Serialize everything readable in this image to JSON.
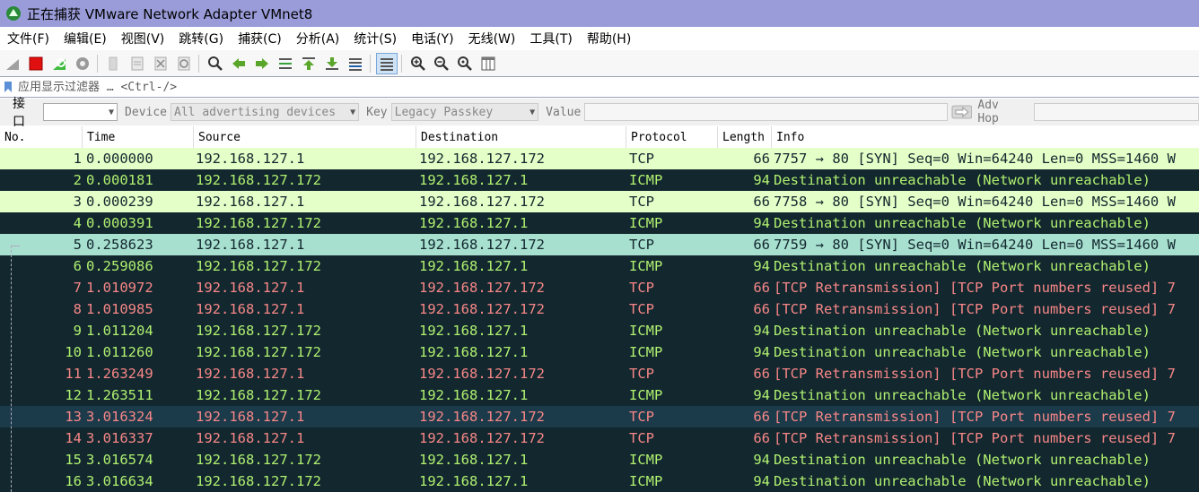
{
  "window": {
    "title": "正在捕获 VMware Network Adapter VMnet8"
  },
  "menu": [
    "文件(F)",
    "编辑(E)",
    "视图(V)",
    "跳转(G)",
    "捕获(C)",
    "分析(A)",
    "统计(S)",
    "电话(Y)",
    "无线(W)",
    "工具(T)",
    "帮助(H)"
  ],
  "toolbar": {
    "icons": [
      "shark-fin-icon",
      "stop-capture-icon",
      "restart-capture-icon",
      "capture-options-icon",
      "open-file-icon",
      "save-file-icon",
      "close-file-icon",
      "reload-file-icon",
      "find-packet-icon",
      "go-back-icon",
      "go-forward-icon",
      "go-to-packet-icon",
      "go-first-icon",
      "go-last-icon",
      "auto-scroll-icon",
      "colorize-icon",
      "zoom-in-icon",
      "zoom-out-icon",
      "zoom-normal-icon",
      "resize-columns-icon"
    ]
  },
  "filter": {
    "placeholder": "应用显示过滤器 … <Ctrl-/>"
  },
  "bluetooth": {
    "interface_label": "接口",
    "interface_value": "",
    "device_label": "Device",
    "device_value": "All advertising devices",
    "key_label": "Key",
    "key_value": "Legacy Passkey",
    "value_label": "Value",
    "adv_hop_label": "Adv Hop"
  },
  "columns": [
    "No.",
    "Time",
    "Source",
    "Destination",
    "Protocol",
    "Length",
    "Info"
  ],
  "packets": [
    {
      "no": "1",
      "time": "0.000000",
      "src": "192.168.127.1",
      "dst": "192.168.127.172",
      "proto": "TCP",
      "len": "66",
      "info": "7757 → 80 [SYN] Seq=0 Win=64240 Len=0 MSS=1460 W",
      "style": "tcp"
    },
    {
      "no": "2",
      "time": "0.000181",
      "src": "192.168.127.172",
      "dst": "192.168.127.1",
      "proto": "ICMP",
      "len": "94",
      "info": "Destination unreachable (Network unreachable)",
      "style": "icmp"
    },
    {
      "no": "3",
      "time": "0.000239",
      "src": "192.168.127.1",
      "dst": "192.168.127.172",
      "proto": "TCP",
      "len": "66",
      "info": "7758 → 80 [SYN] Seq=0 Win=64240 Len=0 MSS=1460 W",
      "style": "tcp"
    },
    {
      "no": "4",
      "time": "0.000391",
      "src": "192.168.127.172",
      "dst": "192.168.127.1",
      "proto": "ICMP",
      "len": "94",
      "info": "Destination unreachable (Network unreachable)",
      "style": "icmp"
    },
    {
      "no": "5",
      "time": "0.258623",
      "src": "192.168.127.1",
      "dst": "192.168.127.172",
      "proto": "TCP",
      "len": "66",
      "info": "7759 → 80 [SYN] Seq=0 Win=64240 Len=0 MSS=1460 W",
      "style": "sel"
    },
    {
      "no": "6",
      "time": "0.259086",
      "src": "192.168.127.172",
      "dst": "192.168.127.1",
      "proto": "ICMP",
      "len": "94",
      "info": "Destination unreachable (Network unreachable)",
      "style": "icmp"
    },
    {
      "no": "7",
      "time": "1.010972",
      "src": "192.168.127.1",
      "dst": "192.168.127.172",
      "proto": "TCP",
      "len": "66",
      "info": "[TCP Retransmission] [TCP Port numbers reused] 7",
      "style": "retrans"
    },
    {
      "no": "8",
      "time": "1.010985",
      "src": "192.168.127.1",
      "dst": "192.168.127.172",
      "proto": "TCP",
      "len": "66",
      "info": "[TCP Retransmission] [TCP Port numbers reused] 7",
      "style": "retrans"
    },
    {
      "no": "9",
      "time": "1.011204",
      "src": "192.168.127.172",
      "dst": "192.168.127.1",
      "proto": "ICMP",
      "len": "94",
      "info": "Destination unreachable (Network unreachable)",
      "style": "icmp"
    },
    {
      "no": "10",
      "time": "1.011260",
      "src": "192.168.127.172",
      "dst": "192.168.127.1",
      "proto": "ICMP",
      "len": "94",
      "info": "Destination unreachable (Network unreachable)",
      "style": "icmp"
    },
    {
      "no": "11",
      "time": "1.263249",
      "src": "192.168.127.1",
      "dst": "192.168.127.172",
      "proto": "TCP",
      "len": "66",
      "info": "[TCP Retransmission] [TCP Port numbers reused] 7",
      "style": "retrans"
    },
    {
      "no": "12",
      "time": "1.263511",
      "src": "192.168.127.172",
      "dst": "192.168.127.1",
      "proto": "ICMP",
      "len": "94",
      "info": "Destination unreachable (Network unreachable)",
      "style": "icmp"
    },
    {
      "no": "13",
      "time": "3.016324",
      "src": "192.168.127.1",
      "dst": "192.168.127.172",
      "proto": "TCP",
      "len": "66",
      "info": "[TCP Retransmission] [TCP Port numbers reused] 7",
      "style": "retrans-alt"
    },
    {
      "no": "14",
      "time": "3.016337",
      "src": "192.168.127.1",
      "dst": "192.168.127.172",
      "proto": "TCP",
      "len": "66",
      "info": "[TCP Retransmission] [TCP Port numbers reused] 7",
      "style": "retrans"
    },
    {
      "no": "15",
      "time": "3.016574",
      "src": "192.168.127.172",
      "dst": "192.168.127.1",
      "proto": "ICMP",
      "len": "94",
      "info": "Destination unreachable (Network unreachable)",
      "style": "icmp"
    },
    {
      "no": "16",
      "time": "3.016634",
      "src": "192.168.127.172",
      "dst": "192.168.127.1",
      "proto": "ICMP",
      "len": "94",
      "info": "Destination unreachable (Network unreachable)",
      "style": "icmp"
    }
  ],
  "colors": {
    "tcp_bg": "#e4ffc7",
    "icmp_fg": "#b0f070",
    "retrans_fg": "#f78787",
    "dark_bg": "#12272e",
    "selected_bg": "#a8e0d0",
    "titlebar_bg": "#9a9cd9"
  }
}
